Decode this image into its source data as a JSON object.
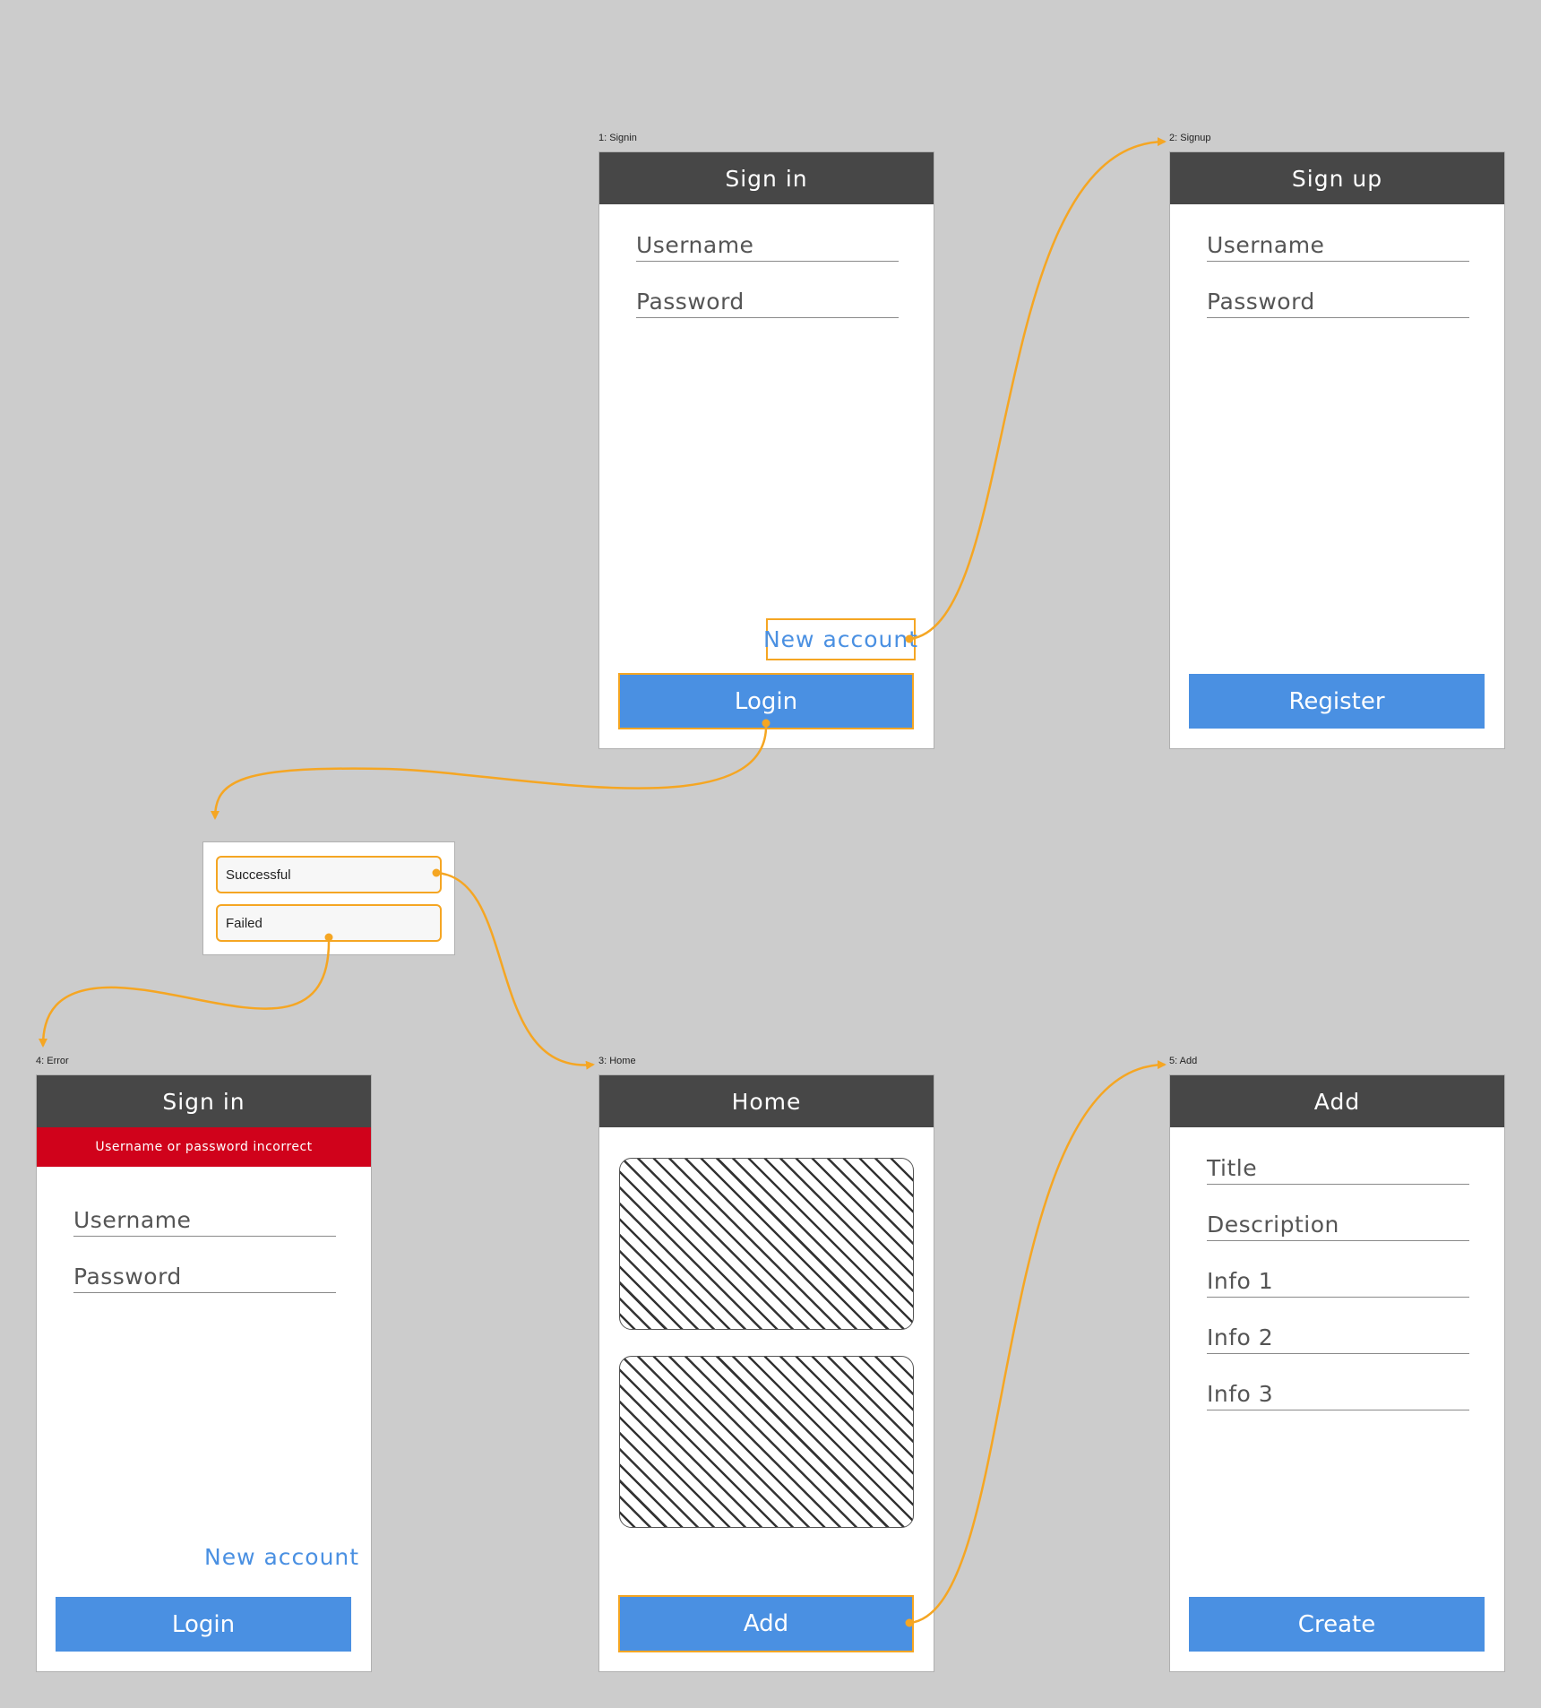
{
  "colors": {
    "background": "#cccccc",
    "navbar": "#474747",
    "accent": "#4a90e2",
    "flow": "#f5a623",
    "error": "#d0021b"
  },
  "screens": {
    "signin": {
      "frame_label": "1: Signin",
      "title": "Sign in",
      "fields": [
        "Username",
        "Password"
      ],
      "link": "New account",
      "button": "Login"
    },
    "signup": {
      "frame_label": "2: Signup",
      "title": "Sign up",
      "fields": [
        "Username",
        "Password"
      ],
      "button": "Register"
    },
    "home": {
      "frame_label": "3: Home",
      "title": "Home",
      "button": "Add"
    },
    "error": {
      "frame_label": "4: Error",
      "title": "Sign in",
      "error_message": "Username or password incorrect",
      "fields": [
        "Username",
        "Password"
      ],
      "link": "New account",
      "button": "Login"
    },
    "add": {
      "frame_label": "5: Add",
      "title": "Add",
      "fields": [
        "Title",
        "Description",
        "Info 1",
        "Info 2",
        "Info 3"
      ],
      "button": "Create"
    }
  },
  "decision": {
    "options": [
      "Successful",
      "Failed"
    ]
  },
  "flows": [
    {
      "from": "signin.link",
      "to": "signup"
    },
    {
      "from": "signin.button",
      "to": "decision"
    },
    {
      "from": "decision.successful",
      "to": "home"
    },
    {
      "from": "decision.failed",
      "to": "error"
    },
    {
      "from": "home.button",
      "to": "add"
    }
  ]
}
